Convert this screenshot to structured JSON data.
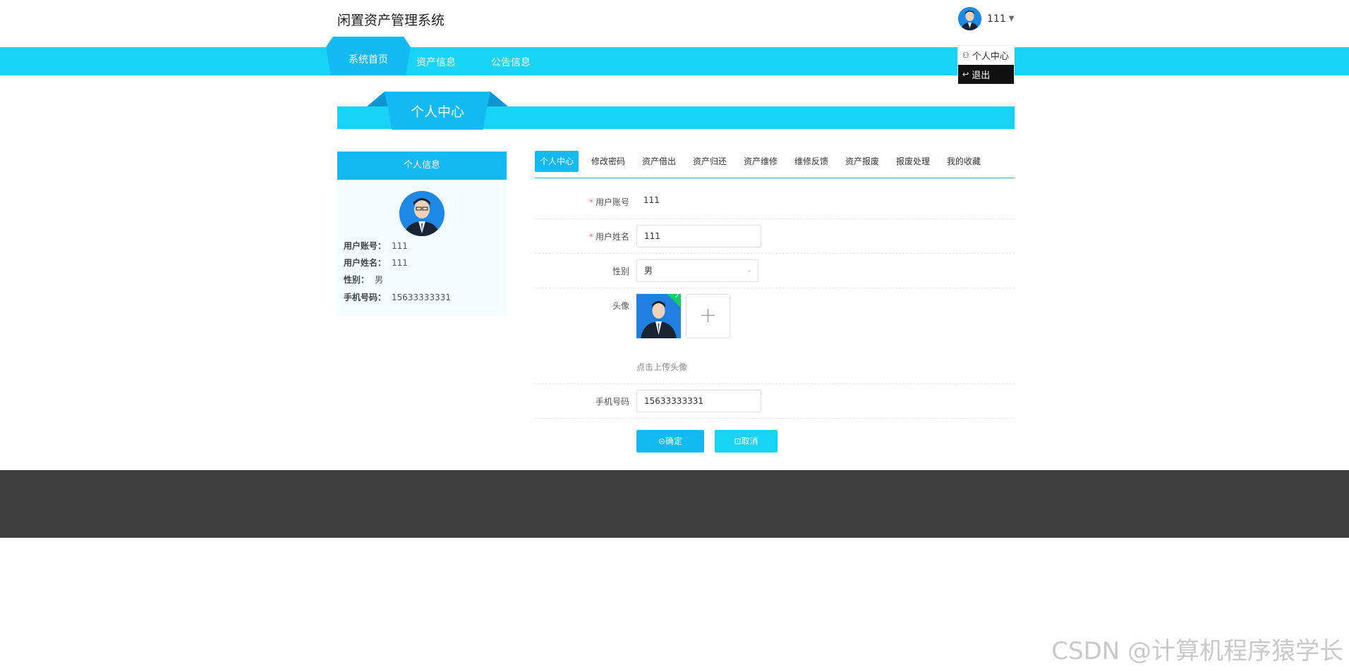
{
  "header": {
    "site_title": "闲置资产管理系统",
    "user_name": "111"
  },
  "nav": {
    "items": [
      {
        "label": "系统首页"
      },
      {
        "label": "资产信息"
      },
      {
        "label": "公告信息"
      }
    ]
  },
  "user_menu": {
    "items": [
      {
        "label": "个人中心",
        "icon": "user-icon"
      },
      {
        "label": "退出",
        "icon": "logout-icon"
      }
    ]
  },
  "section": {
    "title": "个人中心"
  },
  "profile_card": {
    "title": "个人信息",
    "rows": [
      {
        "label": "用户账号：",
        "value": "111"
      },
      {
        "label": "用户姓名：",
        "value": "111"
      },
      {
        "label": "性别：",
        "value": "男"
      },
      {
        "label": "手机号码：",
        "value": "15633333331"
      }
    ]
  },
  "tabs": [
    {
      "label": "个人中心",
      "active": true
    },
    {
      "label": "修改密码"
    },
    {
      "label": "资产借出"
    },
    {
      "label": "资产归还"
    },
    {
      "label": "资产维修"
    },
    {
      "label": "维修反馈"
    },
    {
      "label": "资产报废"
    },
    {
      "label": "报废处理"
    },
    {
      "label": "我的收藏"
    }
  ],
  "form": {
    "account": {
      "label": "用户账号",
      "required": "*",
      "value": "111"
    },
    "name": {
      "label": "用户姓名",
      "required": "*",
      "value": "111"
    },
    "gender": {
      "label": "性别",
      "value": "男"
    },
    "avatar": {
      "label": "头像",
      "hint": "点击上传头像",
      "add_symbol": "+"
    },
    "phone": {
      "label": "手机号码",
      "value": "15633333331"
    },
    "confirm_label": "确定",
    "cancel_label": "取消"
  },
  "watermark": "CSDN @计算机程序猿学长",
  "colors": {
    "primary": "#13b9f2",
    "nav_bar": "#17d4f5",
    "footer": "#404040",
    "success": "#13ce66"
  }
}
